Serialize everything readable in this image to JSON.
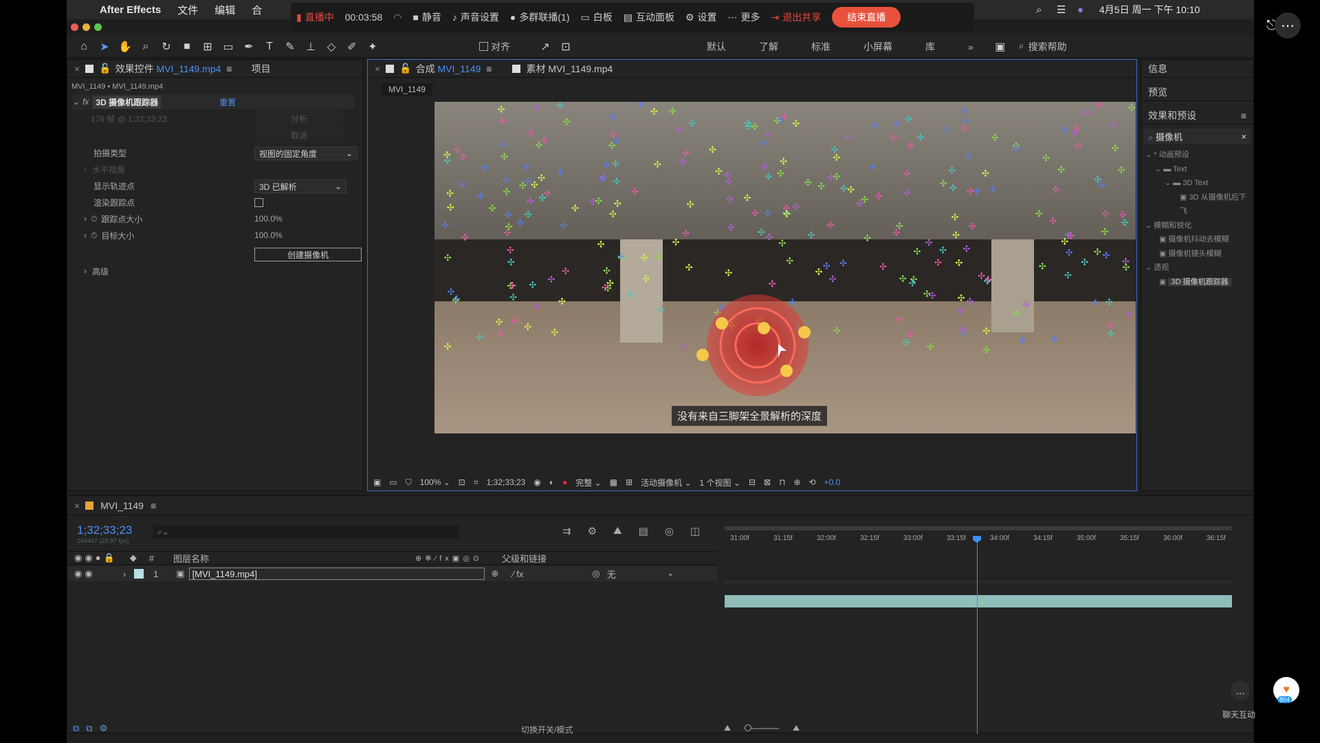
{
  "mac_menu": {
    "app": "After Effects",
    "file": "文件",
    "edit": "编辑",
    "comp_trunc": "合",
    "datetime": "4月5日 周一 下午 10:10"
  },
  "live_bar": {
    "status": "直播中",
    "timer": "00:03:58",
    "mute": "静音",
    "audio": "声音设置",
    "multi": "多群联播(1)",
    "whiteboard": "白板",
    "interactive": "互动面板",
    "settings": "设置",
    "more": "更多",
    "exit_share": "退出共享",
    "end": "结束直播"
  },
  "workspaces": {
    "align": "对齐",
    "default": "默认",
    "learn": "了解",
    "standard": "标准",
    "small": "小屏幕",
    "library": "库",
    "search_help": "搜索帮助"
  },
  "effect_panel": {
    "tab": "效果控件",
    "tab_file": "MVI_1149.mp4",
    "tab_project": "项目",
    "breadcrumb": "MVI_1149 • MVI_1149.mp4",
    "fx_name": "3D 摄像机跟踪器",
    "reset": "重置",
    "analyze": "分析",
    "cancel": "取消",
    "shoot_type_label": "拍摄类型",
    "shoot_type_value": "视图的固定角度",
    "horizontal_label": "水平视角",
    "show_points_label": "显示轨迹点",
    "show_points_value": "3D 已解析",
    "render_points_label": "渲染跟踪点",
    "track_size_label": "跟踪点大小",
    "track_size_value": "100.0%",
    "target_size_label": "目标大小",
    "target_size_value": "100.0%",
    "create_camera": "创建摄像机",
    "advanced": "高级"
  },
  "comp_panel": {
    "tab": "合成",
    "tab_name": "MVI_1149",
    "footage_tab": "素材",
    "footage_name": "MVI_1149.mp4",
    "sub_tab": "MVI_1149",
    "subtitle": "没有来自三脚架全景解析的深度"
  },
  "viewer_bar": {
    "zoom": "100%",
    "timecode": "1;32;33;23",
    "quality": "完整",
    "camera": "活动摄像机",
    "views": "1 个视图",
    "exposure": "+0.0"
  },
  "right_panel": {
    "info": "信息",
    "preview": "预览",
    "effects_presets": "效果和预设",
    "search_value": "摄像机",
    "tree": [
      "* 动画预设",
      "Text",
      "3D Text",
      "3D 从摄像机后下飞",
      "模糊和锐化",
      "摄像机抖动去模糊",
      "摄像机镜头模糊",
      "透视",
      "3D 摄像机跟踪器"
    ]
  },
  "timeline": {
    "tab": "MVI_1149",
    "timecode": "1;32;33;23",
    "frame_info": "166447 (29.97 fps)",
    "col_name": "图层名称",
    "col_parent": "父级和链接",
    "layer_num": "1",
    "layer_name": "[MVI_1149.mp4]",
    "parent_value": "无",
    "ruler": [
      "31:00f",
      "31:15f",
      "32:00f",
      "32:15f",
      "33:00f",
      "33:15f",
      "34:00f",
      "34:15f",
      "35:00f",
      "35:15f",
      "36:00f",
      "36:15f"
    ],
    "toggle_modes": "切换开关/模式"
  },
  "overlay": {
    "chat": "聊天互动",
    "badge": "804"
  }
}
